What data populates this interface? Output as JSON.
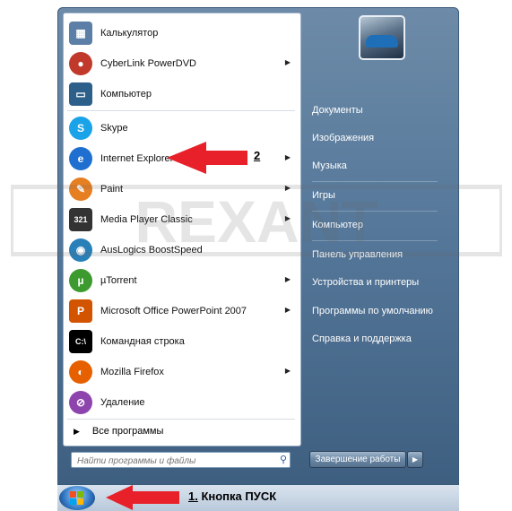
{
  "start_menu": {
    "programs": [
      {
        "label": "Калькулятор",
        "icon": "calculator-icon",
        "color": "#5b7fa6",
        "submenu": false
      },
      {
        "label": "CyberLink PowerDVD",
        "icon": "powerdvd-icon",
        "color": "#c0392b",
        "submenu": true
      },
      {
        "label": "Компьютер",
        "icon": "computer-icon",
        "color": "#2c5f8a",
        "submenu": false
      },
      {
        "label": "Skype",
        "icon": "skype-icon",
        "color": "#1aa3e8",
        "submenu": false
      },
      {
        "label": "Internet Explorer",
        "icon": "internet-explorer-icon",
        "color": "#1f6fd1",
        "submenu": true
      },
      {
        "label": "Paint",
        "icon": "paint-icon",
        "color": "#e67e22",
        "submenu": true
      },
      {
        "label": "Media Player Classic",
        "icon": "media-player-classic-icon",
        "color": "#333333",
        "submenu": true
      },
      {
        "label": "AusLogics BoostSpeed",
        "icon": "auslogics-boostspeed-icon",
        "color": "#2980b9",
        "submenu": false
      },
      {
        "label": "µTorrent",
        "icon": "utorrent-icon",
        "color": "#3c9a2e",
        "submenu": true
      },
      {
        "label": "Microsoft Office PowerPoint 2007",
        "icon": "powerpoint-icon",
        "color": "#d35400",
        "submenu": true
      },
      {
        "label": "Командная строка",
        "icon": "command-prompt-icon",
        "color": "#000000",
        "submenu": false
      },
      {
        "label": "Mozilla Firefox",
        "icon": "firefox-icon",
        "color": "#e66000",
        "submenu": true
      },
      {
        "label": "Удаление",
        "icon": "uninstall-icon",
        "color": "#8e44ad",
        "submenu": false
      }
    ],
    "all_programs": "Все программы",
    "search_placeholder": "Найти программы и файлы",
    "right_items": [
      "Документы",
      "Изображения",
      "Музыка",
      "Игры",
      "Компьютер",
      "Панель управления",
      "Устройства и принтеры",
      "Программы по умолчанию",
      "Справка и поддержка"
    ],
    "shutdown_label": "Завершение работы"
  },
  "annotations": {
    "start_number": "1.",
    "start_text": " Кнопка ПУСК",
    "ie_number": "2"
  },
  "watermark": "REXANT",
  "colors": {
    "arrow": "#e8202a",
    "menu_blue": "#56789a",
    "selected_text": "#111111"
  }
}
